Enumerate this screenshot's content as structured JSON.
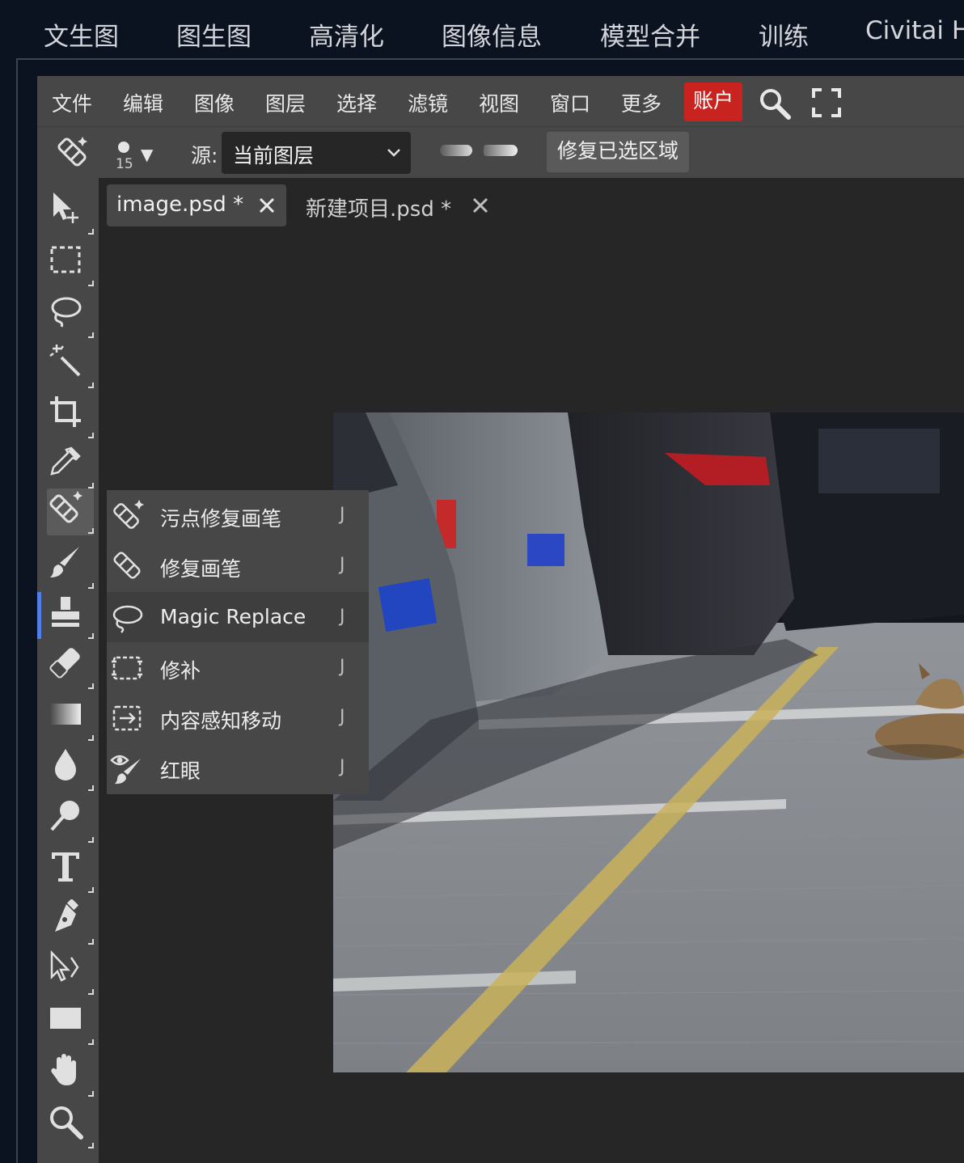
{
  "top_tabs": [
    "文生图",
    "图生图",
    "高清化",
    "图像信息",
    "模型合并",
    "训练",
    "Civitai He"
  ],
  "menu": {
    "items": [
      "文件",
      "编辑",
      "图像",
      "图层",
      "选择",
      "滤镜",
      "视图",
      "窗口",
      "更多"
    ],
    "account_label": "账户",
    "account_color": "#c8231e"
  },
  "options": {
    "brush_size": "15",
    "brush_arrow": "▼",
    "source_label": "源:",
    "source_value": "当前图层",
    "heal_selected_label": "修复已选区域"
  },
  "toolbar": {
    "active_color": "#4f7fe8",
    "tools": [
      "move-icon",
      "marquee-icon",
      "lasso-icon",
      "magic-wand-icon",
      "crop-icon",
      "eyedropper-icon",
      "healing-brush-icon",
      "brush-icon",
      "stamp-icon",
      "eraser-icon",
      "gradient-icon",
      "blur-icon",
      "dodge-icon",
      "type-icon",
      "pen-icon",
      "path-select-icon",
      "rectangle-icon",
      "hand-icon",
      "zoom-icon"
    ]
  },
  "doc_tabs": [
    {
      "label": "image.psd *",
      "active": true
    },
    {
      "label": "新建项目.psd *",
      "active": false
    }
  ],
  "flyout": {
    "items": [
      {
        "label": "污点修复画笔",
        "key": "J",
        "icon": "spot-healing-icon"
      },
      {
        "label": "修复画笔",
        "key": "J",
        "icon": "healing-brush-icon"
      },
      {
        "label": "Magic Replace",
        "key": "J",
        "icon": "magic-replace-icon"
      },
      {
        "label": "修补",
        "key": "J",
        "icon": "patch-icon"
      },
      {
        "label": "内容感知移动",
        "key": "J",
        "icon": "content-aware-move-icon"
      },
      {
        "label": "红眼",
        "key": "J",
        "icon": "red-eye-icon"
      }
    ]
  }
}
